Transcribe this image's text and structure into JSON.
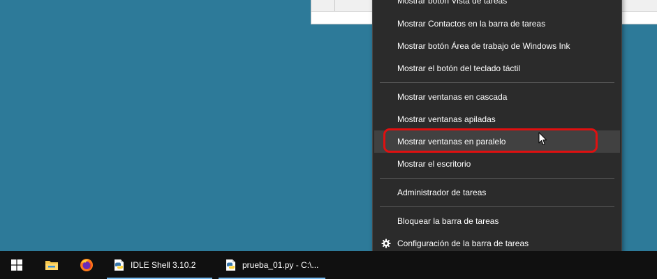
{
  "colors": {
    "desktop": "#2d7a99",
    "menu_bg": "#2b2b2b",
    "menu_hover": "#414141",
    "menu_separator": "#5c5c5c",
    "highlight_ring": "#e01010",
    "taskbar_bg": "#101010",
    "taskbar_active_underline": "#76b9ed"
  },
  "context_menu": {
    "items": [
      {
        "label": "Mostrar botón Vista de tareas"
      },
      {
        "label": "Mostrar Contactos en la barra de tareas"
      },
      {
        "label": "Mostrar botón Área de trabajo de Windows Ink"
      },
      {
        "label": "Mostrar el botón del teclado táctil"
      },
      {
        "label": "Mostrar ventanas en cascada"
      },
      {
        "label": "Mostrar ventanas apiladas"
      },
      {
        "label": "Mostrar ventanas en paralelo"
      },
      {
        "label": "Mostrar el escritorio"
      },
      {
        "label": "Administrador de tareas"
      },
      {
        "label": "Bloquear la barra de tareas"
      },
      {
        "label": "Configuración de la barra de tareas",
        "icon": "gear-icon"
      }
    ],
    "hovered_item": "Mostrar ventanas en paralelo"
  },
  "taskbar": {
    "start_icon": "windows-logo-icon",
    "pinned": [
      {
        "name": "file-explorer-icon"
      },
      {
        "name": "firefox-icon"
      }
    ],
    "apps": [
      {
        "icon": "python-idle-icon",
        "label": "IDLE Shell 3.10.2",
        "running": true
      },
      {
        "icon": "python-idle-icon",
        "label": "prueba_01.py - C:\\...",
        "running": true
      }
    ]
  }
}
